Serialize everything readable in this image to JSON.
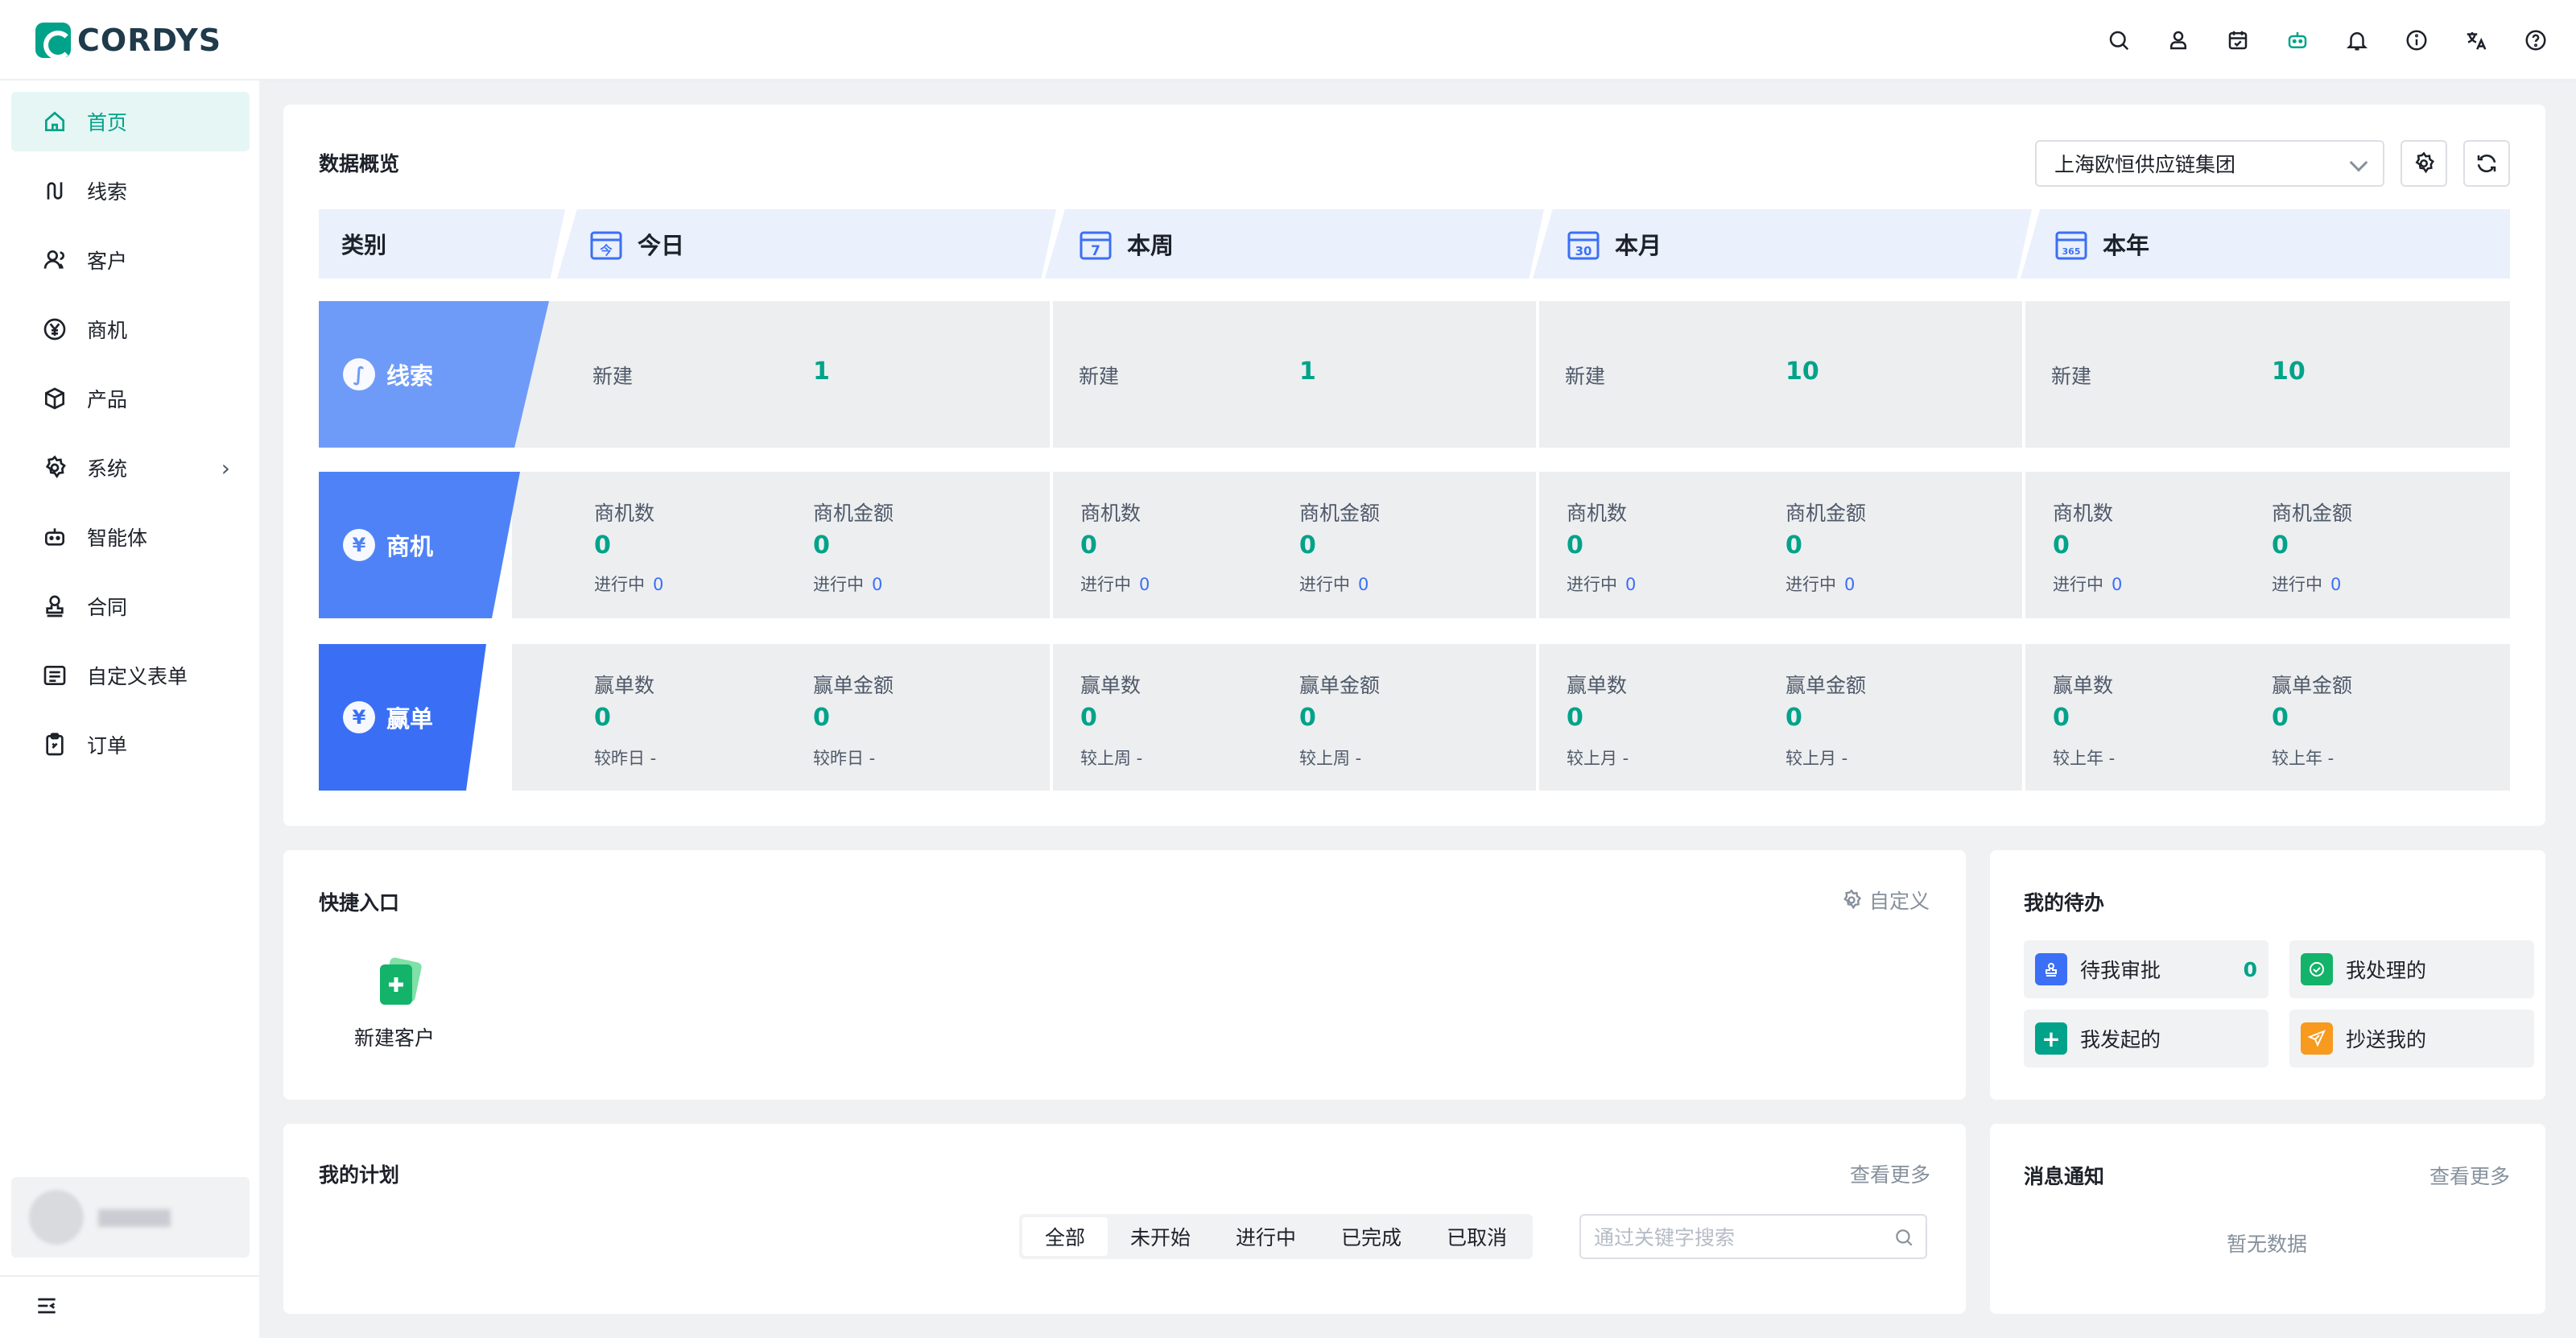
{
  "brand": {
    "name": "CORDYS"
  },
  "top_icons": [
    "search-icon",
    "contact-icon",
    "calendar-icon",
    "robot-icon",
    "bell-icon",
    "info-icon",
    "translate-icon",
    "help-icon"
  ],
  "sidebar": {
    "items": [
      {
        "label": "首页",
        "icon": "home-icon",
        "active": true
      },
      {
        "label": "线索",
        "icon": "clue-icon"
      },
      {
        "label": "客户",
        "icon": "customer-icon"
      },
      {
        "label": "商机",
        "icon": "opportunity-icon"
      },
      {
        "label": "产品",
        "icon": "product-icon"
      },
      {
        "label": "系统",
        "icon": "settings-icon",
        "has_children": true
      },
      {
        "label": "智能体",
        "icon": "robot-icon"
      },
      {
        "label": "合同",
        "icon": "contract-icon"
      },
      {
        "label": "自定义表单",
        "icon": "form-icon"
      },
      {
        "label": "订单",
        "icon": "order-icon"
      }
    ]
  },
  "overview": {
    "title": "数据概览",
    "org_select": "上海欧恒供应链集团",
    "header": {
      "category": "类别",
      "periods": [
        "今日",
        "本周",
        "本月",
        "本年"
      ]
    },
    "calendar_marks": [
      "今",
      "7",
      "30",
      "365"
    ],
    "rows": {
      "clue": {
        "label": "线索",
        "cells": [
          {
            "label": "新建",
            "value": "1"
          },
          {
            "label": "新建",
            "value": "1"
          },
          {
            "label": "新建",
            "value": "10"
          },
          {
            "label": "新建",
            "value": "10"
          }
        ]
      },
      "opportunity": {
        "label": "商机",
        "cells": [
          {
            "a_label": "商机数",
            "a_value": "0",
            "a_sub": "进行中",
            "a_sub_value": "0",
            "b_label": "商机金额",
            "b_value": "0",
            "b_sub": "进行中",
            "b_sub_value": "0"
          },
          {
            "a_label": "商机数",
            "a_value": "0",
            "a_sub": "进行中",
            "a_sub_value": "0",
            "b_label": "商机金额",
            "b_value": "0",
            "b_sub": "进行中",
            "b_sub_value": "0"
          },
          {
            "a_label": "商机数",
            "a_value": "0",
            "a_sub": "进行中",
            "a_sub_value": "0",
            "b_label": "商机金额",
            "b_value": "0",
            "b_sub": "进行中",
            "b_sub_value": "0"
          },
          {
            "a_label": "商机数",
            "a_value": "0",
            "a_sub": "进行中",
            "a_sub_value": "0",
            "b_label": "商机金额",
            "b_value": "0",
            "b_sub": "进行中",
            "b_sub_value": "0"
          }
        ]
      },
      "won": {
        "label": "赢单",
        "cells": [
          {
            "a_label": "赢单数",
            "a_value": "0",
            "a_sub": "较昨日 -",
            "b_label": "赢单金额",
            "b_value": "0",
            "b_sub": "较昨日 -"
          },
          {
            "a_label": "赢单数",
            "a_value": "0",
            "a_sub": "较上周 -",
            "b_label": "赢单金额",
            "b_value": "0",
            "b_sub": "较上周 -"
          },
          {
            "a_label": "赢单数",
            "a_value": "0",
            "a_sub": "较上月 -",
            "b_label": "赢单金额",
            "b_value": "0",
            "b_sub": "较上月 -"
          },
          {
            "a_label": "赢单数",
            "a_value": "0",
            "a_sub": "较上年 -",
            "b_label": "赢单金额",
            "b_value": "0",
            "b_sub": "较上年 -"
          }
        ]
      }
    }
  },
  "quick_entry": {
    "title": "快捷入口",
    "customize": "自定义",
    "items": [
      {
        "label": "新建客户",
        "icon": "new-customer-icon"
      }
    ]
  },
  "todo": {
    "title": "我的待办",
    "items": [
      {
        "label": "待我审批",
        "count": "0",
        "icon": "approval-icon",
        "color": "#3b6ff5"
      },
      {
        "label": "我处理的",
        "icon": "check-icon",
        "color": "#13b36a"
      },
      {
        "label": "我发起的",
        "icon": "plus-icon",
        "color": "#00a389"
      },
      {
        "label": "抄送我的",
        "icon": "send-icon",
        "color": "#f79a1e"
      }
    ]
  },
  "plan": {
    "title": "我的计划",
    "more": "查看更多",
    "tabs": [
      "全部",
      "未开始",
      "进行中",
      "已完成",
      "已取消"
    ],
    "active_tab": "全部",
    "search_placeholder": "通过关键字搜索"
  },
  "notice": {
    "title": "消息通知",
    "more": "查看更多",
    "empty": "暂无数据"
  },
  "colors": {
    "accent": "#00a389",
    "blue": "#3b6ff5",
    "clue_band": "#6f9bf8",
    "opp_band": "#4f82f6",
    "won_band": "#3a6ff5"
  }
}
